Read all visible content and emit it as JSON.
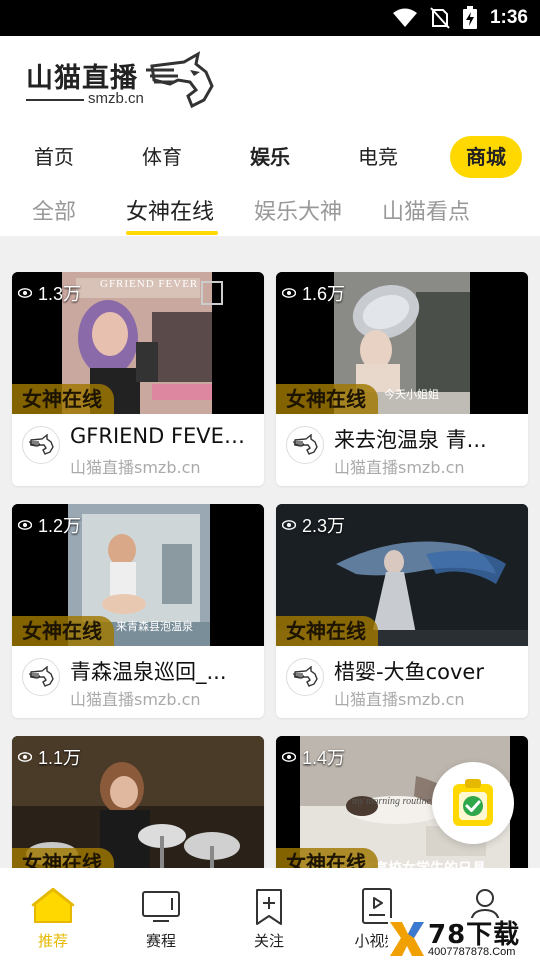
{
  "status_bar": {
    "time": "1:36",
    "icons": [
      "wifi-icon",
      "no-sim-icon",
      "battery-charging-icon"
    ]
  },
  "logo": {
    "title": "山猫直播",
    "domain": "smzb.cn"
  },
  "category_tabs": [
    {
      "label": "首页"
    },
    {
      "label": "体育"
    },
    {
      "label": "娱乐"
    },
    {
      "label": "电竞"
    },
    {
      "label": "商城"
    }
  ],
  "sub_tabs": [
    {
      "label": "全部"
    },
    {
      "label": "女神在线",
      "active": true
    },
    {
      "label": "娱乐大神"
    },
    {
      "label": "山猫看点"
    }
  ],
  "cards": [
    {
      "views": "1.3万",
      "tag": "女神在线",
      "title": "GFRIEND FEVER...",
      "subtitle": "山猫直播smzb.cn",
      "thumb_caption": "GFRIEND FEVER"
    },
    {
      "views": "1.6万",
      "tag": "女神在线",
      "title": "来去泡温泉 青...",
      "subtitle": "山猫直播smzb.cn",
      "thumb_caption": "今天小姐姐"
    },
    {
      "views": "1.2万",
      "tag": "女神在线",
      "title": "青森温泉巡回_...",
      "subtitle": "山猫直播smzb.cn",
      "thumb_caption": "来青森县泡温泉"
    },
    {
      "views": "2.3万",
      "tag": "女神在线",
      "title": "棤婴-大鱼cover",
      "subtitle": "山猫直播smzb.cn",
      "thumb_caption": ""
    },
    {
      "views": "1.1万",
      "tag": "女神在线",
      "title": "",
      "subtitle": "",
      "thumb_caption": ""
    },
    {
      "views": "1.4万",
      "tag": "女神在线",
      "title": "",
      "subtitle": "",
      "thumb_caption": "本高校女学生的日具"
    }
  ],
  "bottom_nav": [
    {
      "label": "推荐",
      "icon": "home-icon",
      "active": true
    },
    {
      "label": "赛程",
      "icon": "tv-icon"
    },
    {
      "label": "关注",
      "icon": "bookmark-plus-icon"
    },
    {
      "label": "小视频",
      "icon": "video-file-icon"
    },
    {
      "label": "我的",
      "icon": "user-icon"
    }
  ],
  "watermark": {
    "text": "78下载",
    "url": "4007787878.Com"
  },
  "colors": {
    "accent": "#ffd800",
    "active_nav": "#e6b800",
    "tag_bg": "#a07800"
  }
}
